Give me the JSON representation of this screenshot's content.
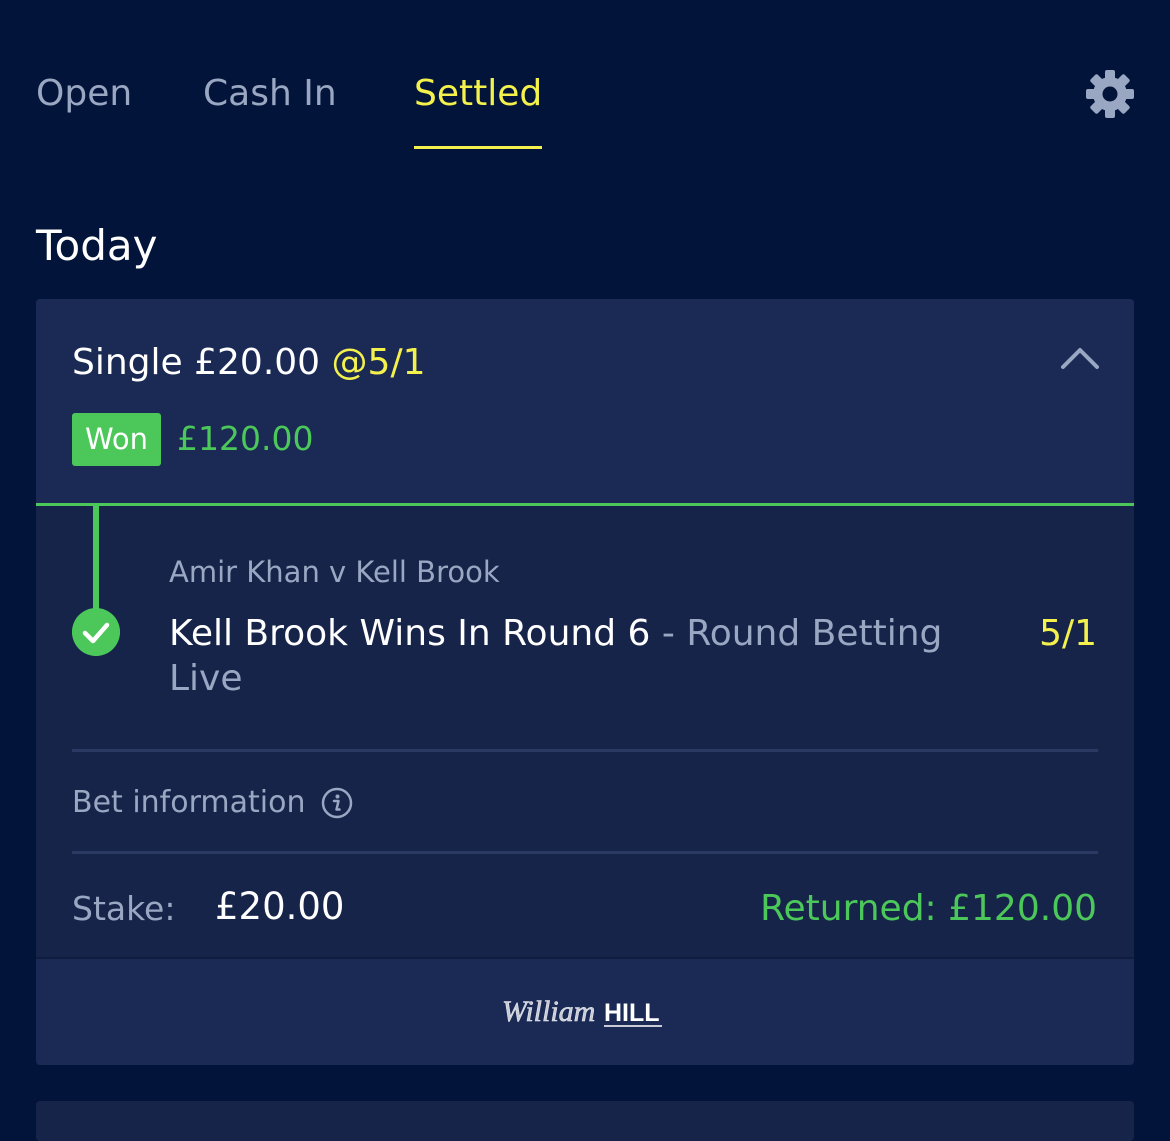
{
  "tabs": {
    "open": "Open",
    "cash_in": "Cash In",
    "settled": "Settled",
    "active": "Settled"
  },
  "section": {
    "title": "Today"
  },
  "bet": {
    "type_stake": "Single £20.00",
    "odds_label": "@5/1",
    "status": "Won",
    "won_amount": "£120.00",
    "event": "Amir Khan v Kell Brook",
    "selection": "Kell Brook Wins In Round 6",
    "separator": " - ",
    "market": "Round Betting Live",
    "selection_odds": "5/1",
    "bet_information_label": "Bet information",
    "stake_label": "Stake:",
    "stake_value": "£20.00",
    "returned": "Returned: £120.00"
  },
  "footer": {
    "logo_script": "William",
    "logo_bold": "HILL"
  },
  "colors": {
    "background": "#03143a",
    "card": "#16244a",
    "accent_yellow": "#f4f14d",
    "won_green": "#4cc85a",
    "muted_text": "#9aa7c2"
  },
  "icons": {
    "settings": "gear-icon",
    "collapse": "chevron-up-icon",
    "selection_status": "check-circle-icon",
    "info": "info-icon"
  }
}
